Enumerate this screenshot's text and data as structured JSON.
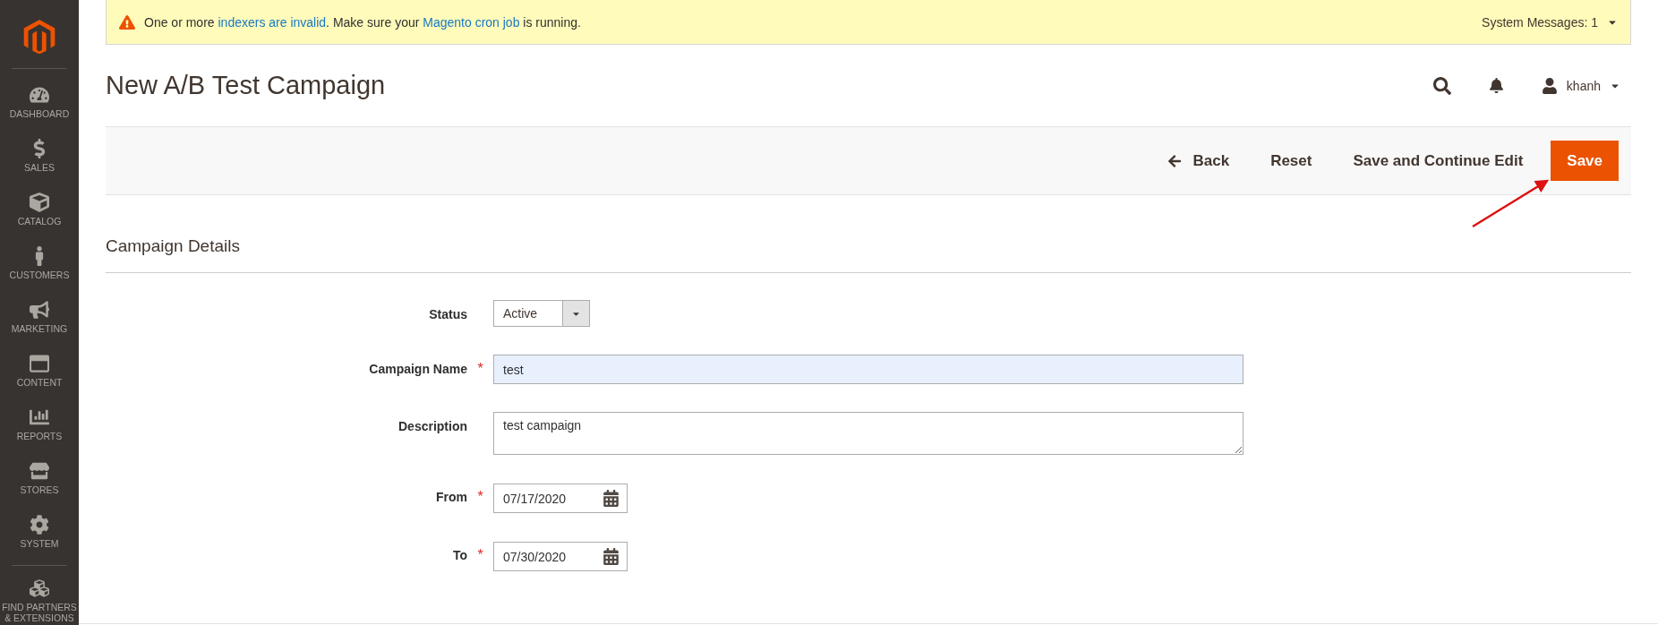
{
  "sidebar": {
    "items": [
      {
        "label": "DASHBOARD",
        "selected": false
      },
      {
        "label": "SALES",
        "selected": false
      },
      {
        "label": "CATALOG",
        "selected": false
      },
      {
        "label": "CUSTOMERS",
        "selected": false
      },
      {
        "label": "MARKETING",
        "selected": false
      },
      {
        "label": "CONTENT",
        "selected": false
      },
      {
        "label": "REPORTS",
        "selected": false
      },
      {
        "label": "STORES",
        "selected": false
      },
      {
        "label": "SYSTEM",
        "selected": false
      },
      {
        "label": "FIND PARTNERS\n& EXTENSIONS",
        "selected": false
      }
    ]
  },
  "system_message": {
    "parts": [
      {
        "kind": "text",
        "text": "One or more "
      },
      {
        "kind": "link",
        "text": "indexers are invalid"
      },
      {
        "kind": "text",
        "text": ". Make sure your "
      },
      {
        "kind": "link",
        "text": "Magento cron job"
      },
      {
        "kind": "text",
        "text": " is running."
      }
    ],
    "counter": "System Messages: 1"
  },
  "page_title": "New A/B Test Campaign",
  "user": {
    "name": "khanh"
  },
  "actions": [
    {
      "kind": "back",
      "label": "Back"
    },
    {
      "kind": "plain",
      "label": "Reset"
    },
    {
      "kind": "plain",
      "label": "Save and Continue Edit"
    },
    {
      "kind": "primary",
      "label": "Save"
    }
  ],
  "section": {
    "title": "Campaign Details"
  },
  "fields": [
    {
      "kind": "select",
      "label": "Status",
      "value": "Active"
    },
    {
      "kind": "text",
      "label": "Campaign Name",
      "required_mark": "*",
      "value": "test"
    },
    {
      "kind": "textarea",
      "label": "Description",
      "value": "test campaign"
    },
    {
      "kind": "date",
      "label": "From",
      "required_mark": "*",
      "value": "07/17/2020"
    },
    {
      "kind": "date",
      "label": "To",
      "required_mark": "*",
      "value": "07/30/2020"
    }
  ]
}
